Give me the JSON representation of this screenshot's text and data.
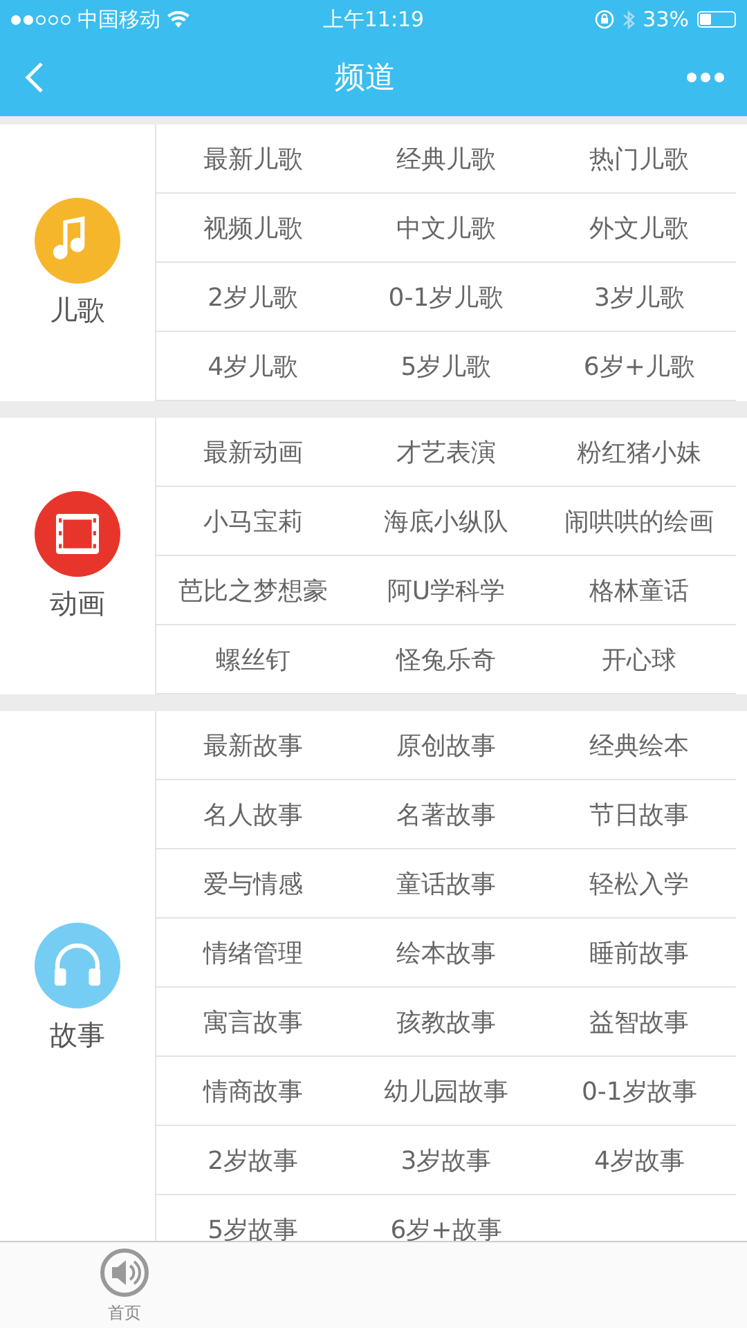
{
  "status_bar": {
    "carrier": "中国移动",
    "time": "上午11:19",
    "battery": "33%"
  },
  "nav": {
    "title": "频道"
  },
  "sections": [
    {
      "kind": "music",
      "label": "儿歌",
      "color": "#f6b62c",
      "items": [
        "最新儿歌",
        "经典儿歌",
        "热门儿歌",
        "视频儿歌",
        "中文儿歌",
        "外文儿歌",
        "2岁儿歌",
        "0-1岁儿歌",
        "3岁儿歌",
        "4岁儿歌",
        "5岁儿歌",
        "6岁+儿歌"
      ]
    },
    {
      "kind": "film",
      "label": "动画",
      "color": "#e8352b",
      "items": [
        "最新动画",
        "才艺表演",
        "粉红猪小妹",
        "小马宝莉",
        "海底小纵队",
        "闹哄哄的绘画",
        "芭比之梦想豪",
        "阿U学科学",
        "格林童话",
        "螺丝钉",
        "怪兔乐奇",
        "开心球"
      ]
    },
    {
      "kind": "headphones",
      "label": "故事",
      "color": "#76cdf3",
      "items": [
        "最新故事",
        "原创故事",
        "经典绘本",
        "名人故事",
        "名著故事",
        "节日故事",
        "爱与情感",
        "童话故事",
        "轻松入学",
        "情绪管理",
        "绘本故事",
        "睡前故事",
        "寓言故事",
        "孩教故事",
        "益智故事",
        "情商故事",
        "幼儿园故事",
        "0-1岁故事",
        "2岁故事",
        "3岁故事",
        "4岁故事",
        "5岁故事",
        "6岁+故事"
      ]
    }
  ],
  "tab_bar": [
    {
      "label": "首页",
      "selected": false
    }
  ]
}
